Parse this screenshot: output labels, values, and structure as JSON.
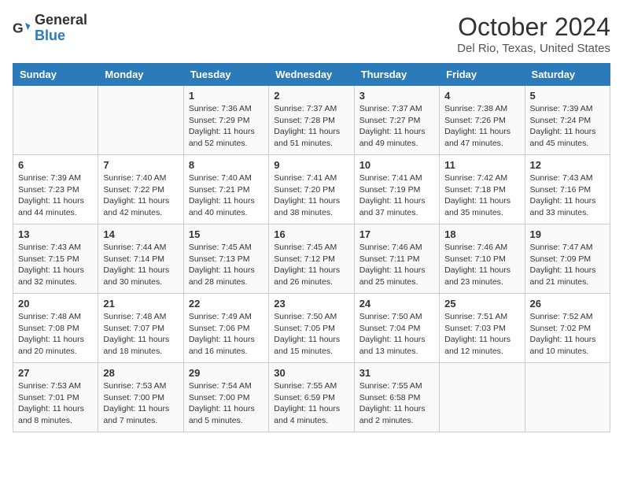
{
  "header": {
    "logo_general": "General",
    "logo_blue": "Blue",
    "month": "October 2024",
    "location": "Del Rio, Texas, United States"
  },
  "weekdays": [
    "Sunday",
    "Monday",
    "Tuesday",
    "Wednesday",
    "Thursday",
    "Friday",
    "Saturday"
  ],
  "weeks": [
    [
      {
        "day": "",
        "sunrise": "",
        "sunset": "",
        "daylight": ""
      },
      {
        "day": "",
        "sunrise": "",
        "sunset": "",
        "daylight": ""
      },
      {
        "day": "1",
        "sunrise": "Sunrise: 7:36 AM",
        "sunset": "Sunset: 7:29 PM",
        "daylight": "Daylight: 11 hours and 52 minutes."
      },
      {
        "day": "2",
        "sunrise": "Sunrise: 7:37 AM",
        "sunset": "Sunset: 7:28 PM",
        "daylight": "Daylight: 11 hours and 51 minutes."
      },
      {
        "day": "3",
        "sunrise": "Sunrise: 7:37 AM",
        "sunset": "Sunset: 7:27 PM",
        "daylight": "Daylight: 11 hours and 49 minutes."
      },
      {
        "day": "4",
        "sunrise": "Sunrise: 7:38 AM",
        "sunset": "Sunset: 7:26 PM",
        "daylight": "Daylight: 11 hours and 47 minutes."
      },
      {
        "day": "5",
        "sunrise": "Sunrise: 7:39 AM",
        "sunset": "Sunset: 7:24 PM",
        "daylight": "Daylight: 11 hours and 45 minutes."
      }
    ],
    [
      {
        "day": "6",
        "sunrise": "Sunrise: 7:39 AM",
        "sunset": "Sunset: 7:23 PM",
        "daylight": "Daylight: 11 hours and 44 minutes."
      },
      {
        "day": "7",
        "sunrise": "Sunrise: 7:40 AM",
        "sunset": "Sunset: 7:22 PM",
        "daylight": "Daylight: 11 hours and 42 minutes."
      },
      {
        "day": "8",
        "sunrise": "Sunrise: 7:40 AM",
        "sunset": "Sunset: 7:21 PM",
        "daylight": "Daylight: 11 hours and 40 minutes."
      },
      {
        "day": "9",
        "sunrise": "Sunrise: 7:41 AM",
        "sunset": "Sunset: 7:20 PM",
        "daylight": "Daylight: 11 hours and 38 minutes."
      },
      {
        "day": "10",
        "sunrise": "Sunrise: 7:41 AM",
        "sunset": "Sunset: 7:19 PM",
        "daylight": "Daylight: 11 hours and 37 minutes."
      },
      {
        "day": "11",
        "sunrise": "Sunrise: 7:42 AM",
        "sunset": "Sunset: 7:18 PM",
        "daylight": "Daylight: 11 hours and 35 minutes."
      },
      {
        "day": "12",
        "sunrise": "Sunrise: 7:43 AM",
        "sunset": "Sunset: 7:16 PM",
        "daylight": "Daylight: 11 hours and 33 minutes."
      }
    ],
    [
      {
        "day": "13",
        "sunrise": "Sunrise: 7:43 AM",
        "sunset": "Sunset: 7:15 PM",
        "daylight": "Daylight: 11 hours and 32 minutes."
      },
      {
        "day": "14",
        "sunrise": "Sunrise: 7:44 AM",
        "sunset": "Sunset: 7:14 PM",
        "daylight": "Daylight: 11 hours and 30 minutes."
      },
      {
        "day": "15",
        "sunrise": "Sunrise: 7:45 AM",
        "sunset": "Sunset: 7:13 PM",
        "daylight": "Daylight: 11 hours and 28 minutes."
      },
      {
        "day": "16",
        "sunrise": "Sunrise: 7:45 AM",
        "sunset": "Sunset: 7:12 PM",
        "daylight": "Daylight: 11 hours and 26 minutes."
      },
      {
        "day": "17",
        "sunrise": "Sunrise: 7:46 AM",
        "sunset": "Sunset: 7:11 PM",
        "daylight": "Daylight: 11 hours and 25 minutes."
      },
      {
        "day": "18",
        "sunrise": "Sunrise: 7:46 AM",
        "sunset": "Sunset: 7:10 PM",
        "daylight": "Daylight: 11 hours and 23 minutes."
      },
      {
        "day": "19",
        "sunrise": "Sunrise: 7:47 AM",
        "sunset": "Sunset: 7:09 PM",
        "daylight": "Daylight: 11 hours and 21 minutes."
      }
    ],
    [
      {
        "day": "20",
        "sunrise": "Sunrise: 7:48 AM",
        "sunset": "Sunset: 7:08 PM",
        "daylight": "Daylight: 11 hours and 20 minutes."
      },
      {
        "day": "21",
        "sunrise": "Sunrise: 7:48 AM",
        "sunset": "Sunset: 7:07 PM",
        "daylight": "Daylight: 11 hours and 18 minutes."
      },
      {
        "day": "22",
        "sunrise": "Sunrise: 7:49 AM",
        "sunset": "Sunset: 7:06 PM",
        "daylight": "Daylight: 11 hours and 16 minutes."
      },
      {
        "day": "23",
        "sunrise": "Sunrise: 7:50 AM",
        "sunset": "Sunset: 7:05 PM",
        "daylight": "Daylight: 11 hours and 15 minutes."
      },
      {
        "day": "24",
        "sunrise": "Sunrise: 7:50 AM",
        "sunset": "Sunset: 7:04 PM",
        "daylight": "Daylight: 11 hours and 13 minutes."
      },
      {
        "day": "25",
        "sunrise": "Sunrise: 7:51 AM",
        "sunset": "Sunset: 7:03 PM",
        "daylight": "Daylight: 11 hours and 12 minutes."
      },
      {
        "day": "26",
        "sunrise": "Sunrise: 7:52 AM",
        "sunset": "Sunset: 7:02 PM",
        "daylight": "Daylight: 11 hours and 10 minutes."
      }
    ],
    [
      {
        "day": "27",
        "sunrise": "Sunrise: 7:53 AM",
        "sunset": "Sunset: 7:01 PM",
        "daylight": "Daylight: 11 hours and 8 minutes."
      },
      {
        "day": "28",
        "sunrise": "Sunrise: 7:53 AM",
        "sunset": "Sunset: 7:00 PM",
        "daylight": "Daylight: 11 hours and 7 minutes."
      },
      {
        "day": "29",
        "sunrise": "Sunrise: 7:54 AM",
        "sunset": "Sunset: 7:00 PM",
        "daylight": "Daylight: 11 hours and 5 minutes."
      },
      {
        "day": "30",
        "sunrise": "Sunrise: 7:55 AM",
        "sunset": "Sunset: 6:59 PM",
        "daylight": "Daylight: 11 hours and 4 minutes."
      },
      {
        "day": "31",
        "sunrise": "Sunrise: 7:55 AM",
        "sunset": "Sunset: 6:58 PM",
        "daylight": "Daylight: 11 hours and 2 minutes."
      },
      {
        "day": "",
        "sunrise": "",
        "sunset": "",
        "daylight": ""
      },
      {
        "day": "",
        "sunrise": "",
        "sunset": "",
        "daylight": ""
      }
    ]
  ]
}
